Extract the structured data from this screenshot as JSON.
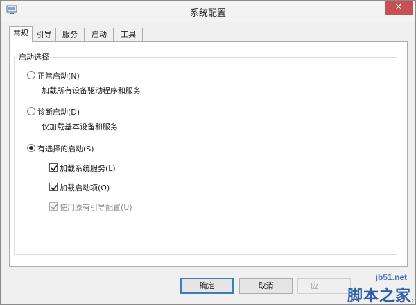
{
  "window": {
    "title": "系统配置",
    "close_label": "✕"
  },
  "tabs": [
    {
      "label": "常规",
      "active": true
    },
    {
      "label": "引导",
      "active": false
    },
    {
      "label": "服务",
      "active": false
    },
    {
      "label": "启动",
      "active": false
    },
    {
      "label": "工具",
      "active": false
    }
  ],
  "startup_group": {
    "legend": "启动选择",
    "normal": {
      "label": "正常启动(N)",
      "desc": "加载所有设备驱动程序和服务",
      "selected": false
    },
    "diagnostic": {
      "label": "诊断启动(D)",
      "desc": "仅加载基本设备和服务",
      "selected": false
    },
    "selective": {
      "label": "有选择的启动(S)",
      "selected": true,
      "options": {
        "load_services": {
          "label": "加载系统服务(L)",
          "checked": true,
          "enabled": true
        },
        "load_startup": {
          "label": "加载启动项(O)",
          "checked": true,
          "enabled": true
        },
        "use_original_boot": {
          "label": "使用原有引导配置(U)",
          "checked": true,
          "enabled": false
        }
      }
    }
  },
  "buttons": {
    "ok": "确定",
    "cancel": "取消",
    "apply": "应"
  },
  "watermark": {
    "url": "jb51.net",
    "name": "脚本之家"
  },
  "colors": {
    "close": "#c75050",
    "default_button_border": "#3c7fb1",
    "watermark": "#2f5fa8"
  }
}
